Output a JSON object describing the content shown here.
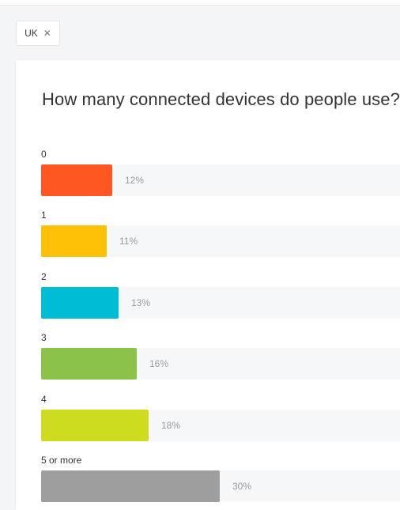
{
  "filter": {
    "chip_label": "UK",
    "close_glyph": "✕",
    "close_icon": "close-icon"
  },
  "chart_data": {
    "type": "bar",
    "orientation": "horizontal",
    "title": "How many connected devices do people use?",
    "categories": [
      "0",
      "1",
      "2",
      "3",
      "4",
      "5 or more"
    ],
    "values": [
      12,
      11,
      13,
      16,
      18,
      30
    ],
    "value_labels": [
      "12%",
      "11%",
      "13%",
      "16%",
      "18%",
      "30%"
    ],
    "colors": [
      "#ff5722",
      "#ffc107",
      "#00bcd4",
      "#8bc34a",
      "#cddc1f",
      "#9e9e9e"
    ],
    "xlim": [
      0,
      30
    ],
    "grid": false
  }
}
